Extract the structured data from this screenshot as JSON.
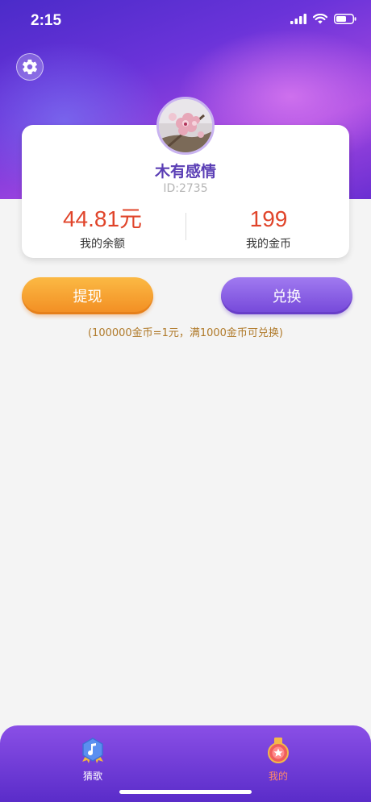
{
  "status_bar": {
    "time": "2:15"
  },
  "profile": {
    "username": "木有感情",
    "user_id": "ID:2735"
  },
  "stats": {
    "balance_value": "44.81元",
    "balance_label": "我的余额",
    "coins_value": "199",
    "coins_label": "我的金币"
  },
  "actions": {
    "withdraw_label": "提现",
    "exchange_label": "兑换",
    "note": "(100000金币=1元，满1000金币可兑换)"
  },
  "tabbar": {
    "tabs": [
      {
        "label": "猜歌",
        "icon": "music-note-icon",
        "active": false
      },
      {
        "label": "我的",
        "icon": "medal-icon",
        "active": true
      }
    ]
  },
  "colors": {
    "accent_purple": "#5b3fb5",
    "value_red": "#e0442a",
    "withdraw_orange": "#f28d22",
    "exchange_purple": "#7447d9",
    "active_tab": "#ff8a6a"
  }
}
